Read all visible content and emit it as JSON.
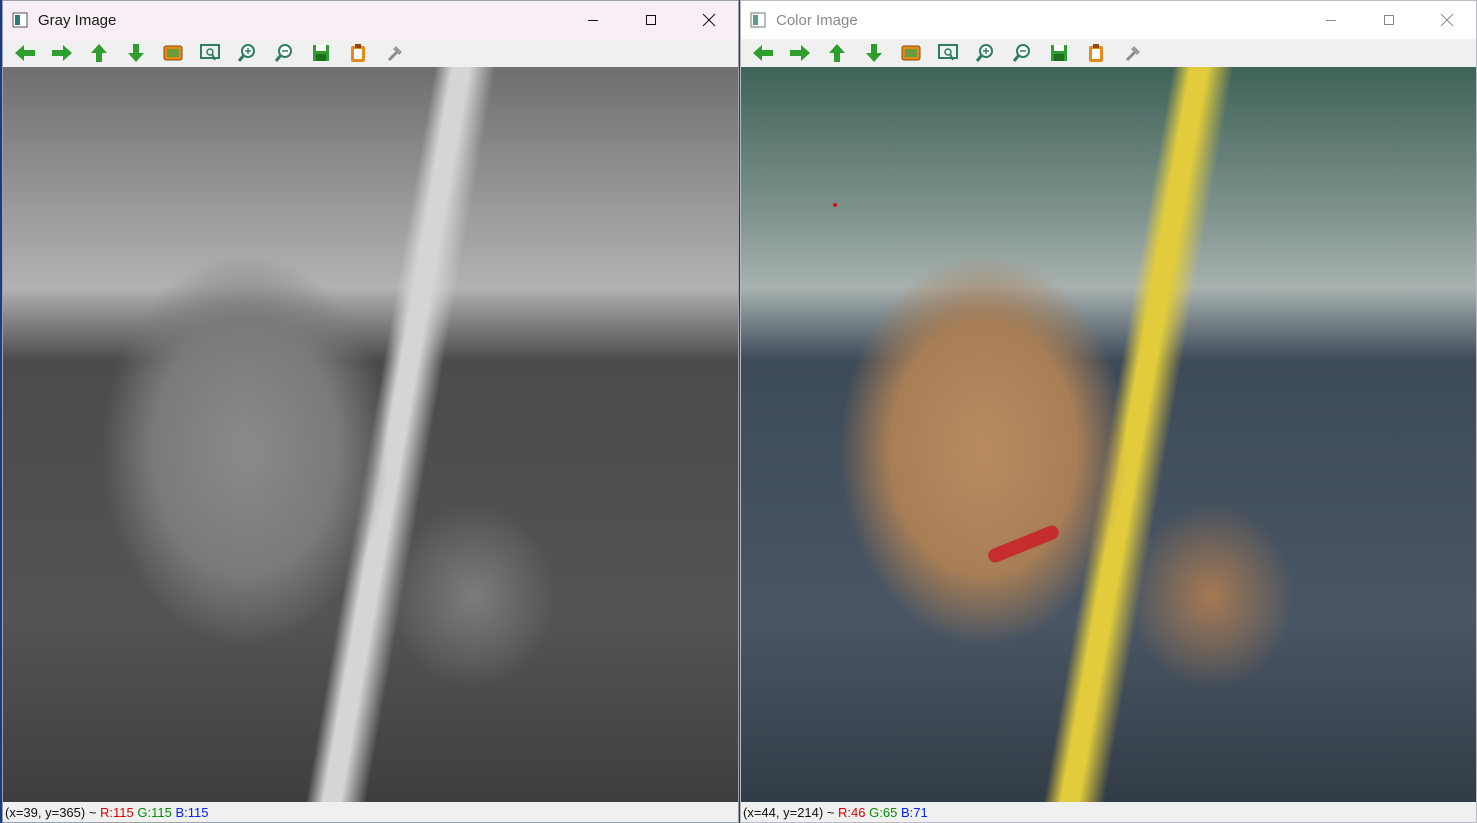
{
  "windows": [
    {
      "id": "gray",
      "title": "Gray Image",
      "status": {
        "prefix": "(x=39, y=365) ~ ",
        "r": "R:115",
        "g": "G:115",
        "b": "B:115"
      }
    },
    {
      "id": "color",
      "title": "Color Image",
      "status": {
        "prefix": "(x=44, y=214) ~ ",
        "r": "R:46",
        "g": "G:65",
        "b": "B:71"
      }
    }
  ],
  "toolbar_icons": [
    "arrow-left-icon",
    "arrow-right-icon",
    "arrow-up-icon",
    "arrow-down-icon",
    "image-icon",
    "zoom-fit-icon",
    "zoom-in-icon",
    "zoom-out-icon",
    "save-icon",
    "copy-icon",
    "properties-icon"
  ],
  "colors": {
    "arrow_green": "#2e9e2e",
    "icon_orange": "#e58b1a",
    "status_r": "#e00000",
    "status_g": "#009000",
    "status_b": "#0020ff"
  }
}
